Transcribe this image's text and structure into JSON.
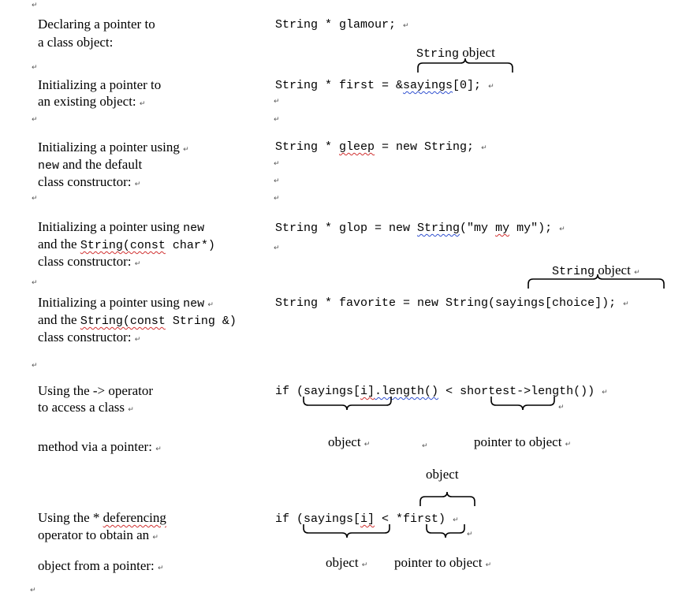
{
  "paragraph_mark": "↵",
  "rows": {
    "declare": {
      "label_1": "Declaring a pointer to",
      "label_2": "a class object:",
      "code": "String * glamour;"
    },
    "annot_string_object_1": {
      "code_word": "String",
      "text": " object"
    },
    "existing": {
      "label_1": "Initializing a pointer to",
      "label_2": "an existing object:",
      "code_pre": "String * first = &",
      "code_sq": "sayings",
      "code_post": "[0];"
    },
    "default_ctor": {
      "label_1": "Initializing a pointer using",
      "label_2_code": "new",
      "label_2_text": " and the default",
      "label_3": "class constructor:",
      "code_pre": "String * ",
      "code_sq": "gleep",
      "code_post": " = new String;"
    },
    "cstr_ctor": {
      "label_1_text": "Initializing a pointer using ",
      "label_1_code": "new",
      "label_2_text": "and the ",
      "label_2_code_sq": "String(const",
      "label_2_code_post": " char*)",
      "label_3": "class constructor:",
      "code_pre": "String * glop = new ",
      "code_sq": "String",
      "code_mid": "(\"my ",
      "code_sq2": "my",
      "code_post": " my\");"
    },
    "annot_string_object_2": {
      "code_word": "String",
      "text": " object"
    },
    "copy_ctor": {
      "label_1_text": "Initializing a pointer using ",
      "label_1_code": "new",
      "label_2_text": "and the ",
      "label_2_code_sq": "String(const",
      "label_2_code_post": " String &)",
      "label_3": "class constructor:",
      "code": "String * favorite = new String(sayings[choice]);"
    },
    "arrow_op": {
      "label_1": "Using the -> operator",
      "label_2": "to access a class",
      "label_3": "method via a pointer:",
      "code_pre": "if (sayings[",
      "code_sq": "i]",
      "code_mid": ".length()",
      "code_post": " < shortest->length())",
      "annot_object": "object",
      "annot_pointer": "pointer to object"
    },
    "deref_op": {
      "annot_top": "object",
      "label_1_text": "Using the * ",
      "label_1_sq": "deferencing",
      "label_2": "operator to obtain an",
      "label_3": "object from a pointer:",
      "code_pre": "if (sayings[",
      "code_sq": "i]",
      "code_post": " < *first)",
      "annot_object": "object",
      "annot_pointer": "pointer to object"
    }
  }
}
